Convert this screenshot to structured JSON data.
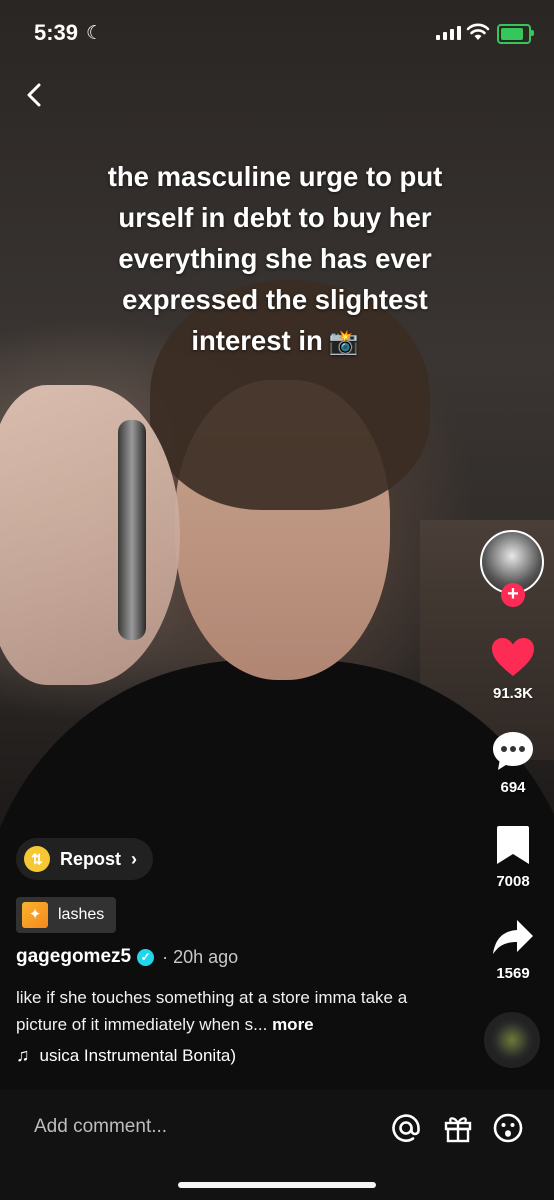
{
  "status_bar": {
    "time": "5:39",
    "moon_icon": "moon-icon",
    "signal_icon": "signal-icon",
    "wifi_icon": "wifi-icon",
    "battery_icon": "battery-charging-icon",
    "battery_color": "#34c759"
  },
  "video": {
    "caption_lines": [
      "the masculine urge to put",
      "urself in debt to buy her",
      "everything she has ever",
      "expressed the slightest",
      "interest in"
    ],
    "caption_emoji": "📸"
  },
  "actions": {
    "like_count": "91.3K",
    "comment_count": "694",
    "bookmark_count": "7008",
    "share_count": "1569",
    "like_color": "#fe2c55"
  },
  "post": {
    "repost_label": "Repost",
    "effect_label": "lashes",
    "username": "gagegomez5",
    "posted_time": "· 20h ago",
    "description": "like if she touches something at a store imma take a picture of it immediately when s...",
    "more_label": "more",
    "music": "usica Instrumental Bonita)"
  },
  "comment_bar": {
    "placeholder": "Add comment..."
  }
}
